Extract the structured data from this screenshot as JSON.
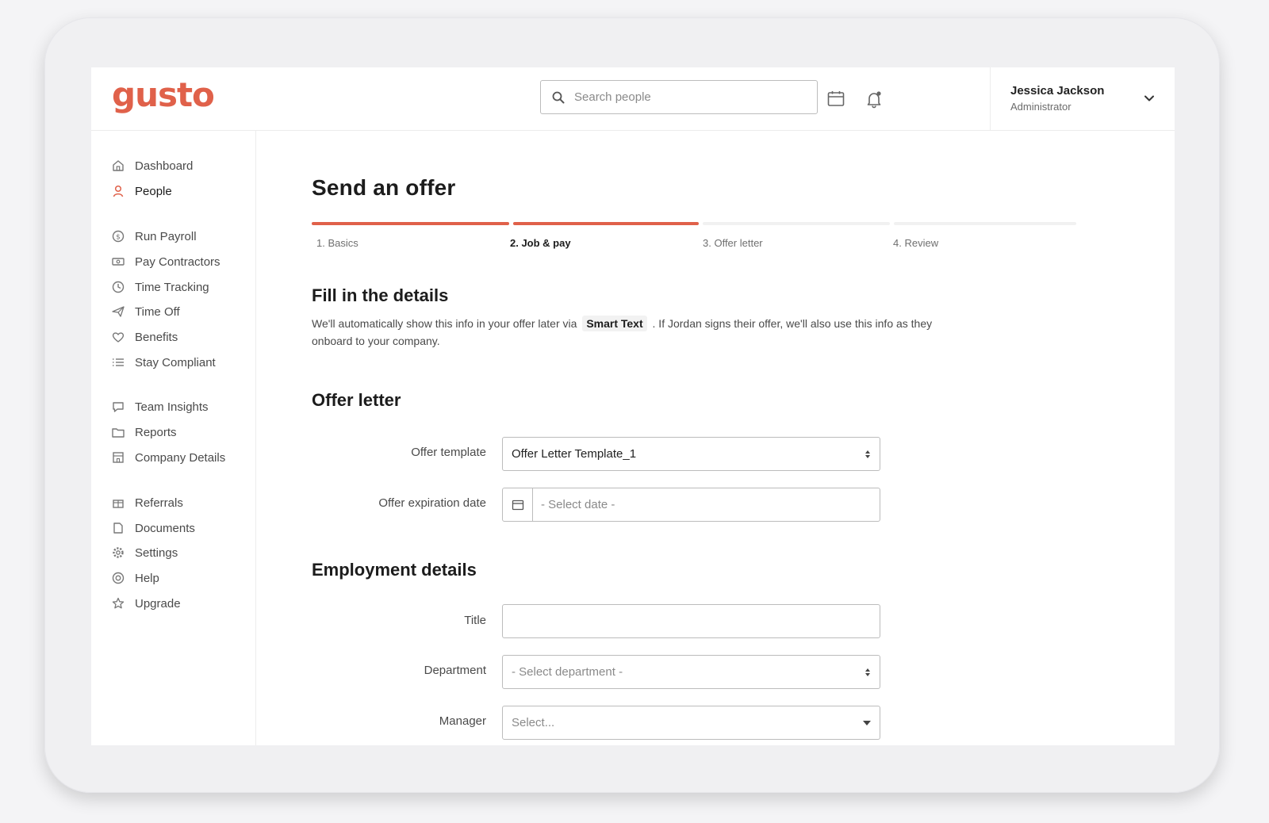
{
  "brand": {
    "logo_text": "gusto",
    "accent": "#e0614a"
  },
  "header": {
    "search_placeholder": "Search people",
    "user_name": "Jessica Jackson",
    "user_role": "Administrator"
  },
  "sidebar": {
    "items": [
      {
        "label": "Dashboard",
        "icon": "home-icon"
      },
      {
        "label": "People",
        "icon": "person-icon",
        "active": true
      },
      {
        "label": "Run Payroll",
        "icon": "dollar-icon"
      },
      {
        "label": "Pay Contractors",
        "icon": "money-icon"
      },
      {
        "label": "Time Tracking",
        "icon": "clock-icon"
      },
      {
        "label": "Time Off",
        "icon": "plane-icon"
      },
      {
        "label": "Benefits",
        "icon": "heart-icon"
      },
      {
        "label": "Stay Compliant",
        "icon": "list-icon"
      },
      {
        "label": "Team Insights",
        "icon": "chat-icon"
      },
      {
        "label": "Reports",
        "icon": "folder-icon"
      },
      {
        "label": "Company Details",
        "icon": "building-icon"
      },
      {
        "label": "Referrals",
        "icon": "gift-icon"
      },
      {
        "label": "Documents",
        "icon": "document-icon"
      },
      {
        "label": "Settings",
        "icon": "gear-icon"
      },
      {
        "label": "Help",
        "icon": "help-icon"
      },
      {
        "label": "Upgrade",
        "icon": "star-icon"
      }
    ]
  },
  "page": {
    "title": "Send an offer",
    "steps": [
      {
        "label": "1. Basics",
        "complete": true
      },
      {
        "label": "2. Job & pay",
        "complete": true,
        "current": true
      },
      {
        "label": "3. Offer letter",
        "complete": false
      },
      {
        "label": "4. Review",
        "complete": false
      }
    ],
    "details": {
      "title": "Fill in the details",
      "desc_before": "We'll automatically show this info in your offer later via",
      "smart_text": "Smart Text",
      "desc_after": ". If Jordan signs their offer, we'll also use this info as they onboard to your company."
    },
    "offer_letter": {
      "title": "Offer letter",
      "template_label": "Offer template",
      "template_value": "Offer Letter Template_1",
      "expiration_label": "Offer expiration date",
      "expiration_placeholder": "- Select date -"
    },
    "employment": {
      "title": "Employment details",
      "title_label": "Title",
      "title_value": "",
      "department_label": "Department",
      "department_placeholder": "- Select department -",
      "manager_label": "Manager",
      "manager_placeholder": "Select..."
    }
  }
}
